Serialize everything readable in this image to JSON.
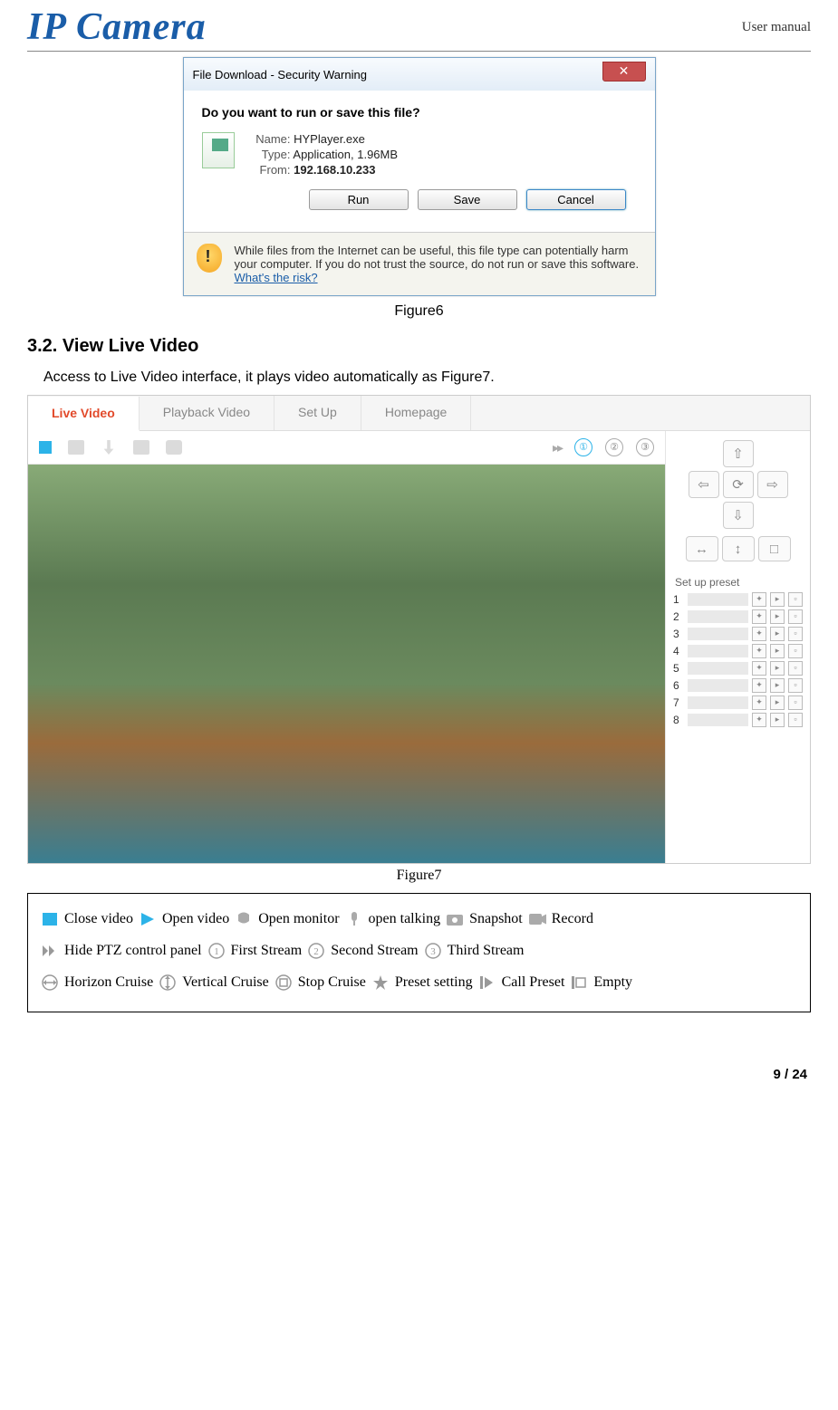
{
  "header": {
    "logo": "IP Camera",
    "right": "User manual"
  },
  "dialog": {
    "title": "File Download - Security Warning",
    "question": "Do you want to run or save this file?",
    "name_label": "Name:",
    "name_value": "HYPlayer.exe",
    "type_label": "Type:",
    "type_value": "Application, 1.96MB",
    "from_label": "From:",
    "from_value": "192.168.10.233",
    "run": "Run",
    "save": "Save",
    "cancel": "Cancel",
    "warning_text": "While files from the Internet can be useful, this file type can potentially harm your computer. If you do not trust the source, do not run or save this software. ",
    "risk_link": "What's the risk?"
  },
  "figure6_caption": "Figure6",
  "section_title": "3.2. View Live Video",
  "access_text": "Access to Live Video interface, it plays video automatically as Figure7.",
  "tabs": {
    "live": "Live Video",
    "playback": "Playback Video",
    "setup": "Set Up",
    "homepage": "Homepage"
  },
  "streams": {
    "s1": "①",
    "s2": "②",
    "s3": "③"
  },
  "ptz": {
    "up": "⇧",
    "down": "⇩",
    "left": "⇦",
    "right": "⇨",
    "center": "⟳",
    "hscan": "↔",
    "vscan": "↕",
    "stop": "□"
  },
  "preset_title": "Set up preset",
  "presets": [
    "1",
    "2",
    "3",
    "4",
    "5",
    "6",
    "7",
    "8"
  ],
  "figure7_caption": "Figure7",
  "legend": {
    "close_video": "Close video",
    "open_video": "Open video",
    "open_monitor": "Open monitor",
    "open_talking": "open talking",
    "snapshot": "Snapshot",
    "record": "Record",
    "hide_ptz": "Hide PTZ control panel",
    "first_stream": "First Stream",
    "second_stream": "Second Stream",
    "third_stream": "Third Stream",
    "horizon_cruise": "Horizon Cruise",
    "vertical_cruise": "Vertical Cruise",
    "stop_cruise": "Stop Cruise",
    "preset_setting": "Preset setting",
    "call_preset": "Call Preset",
    "empty": "Empty"
  },
  "footer": {
    "page": "9 / 24"
  }
}
